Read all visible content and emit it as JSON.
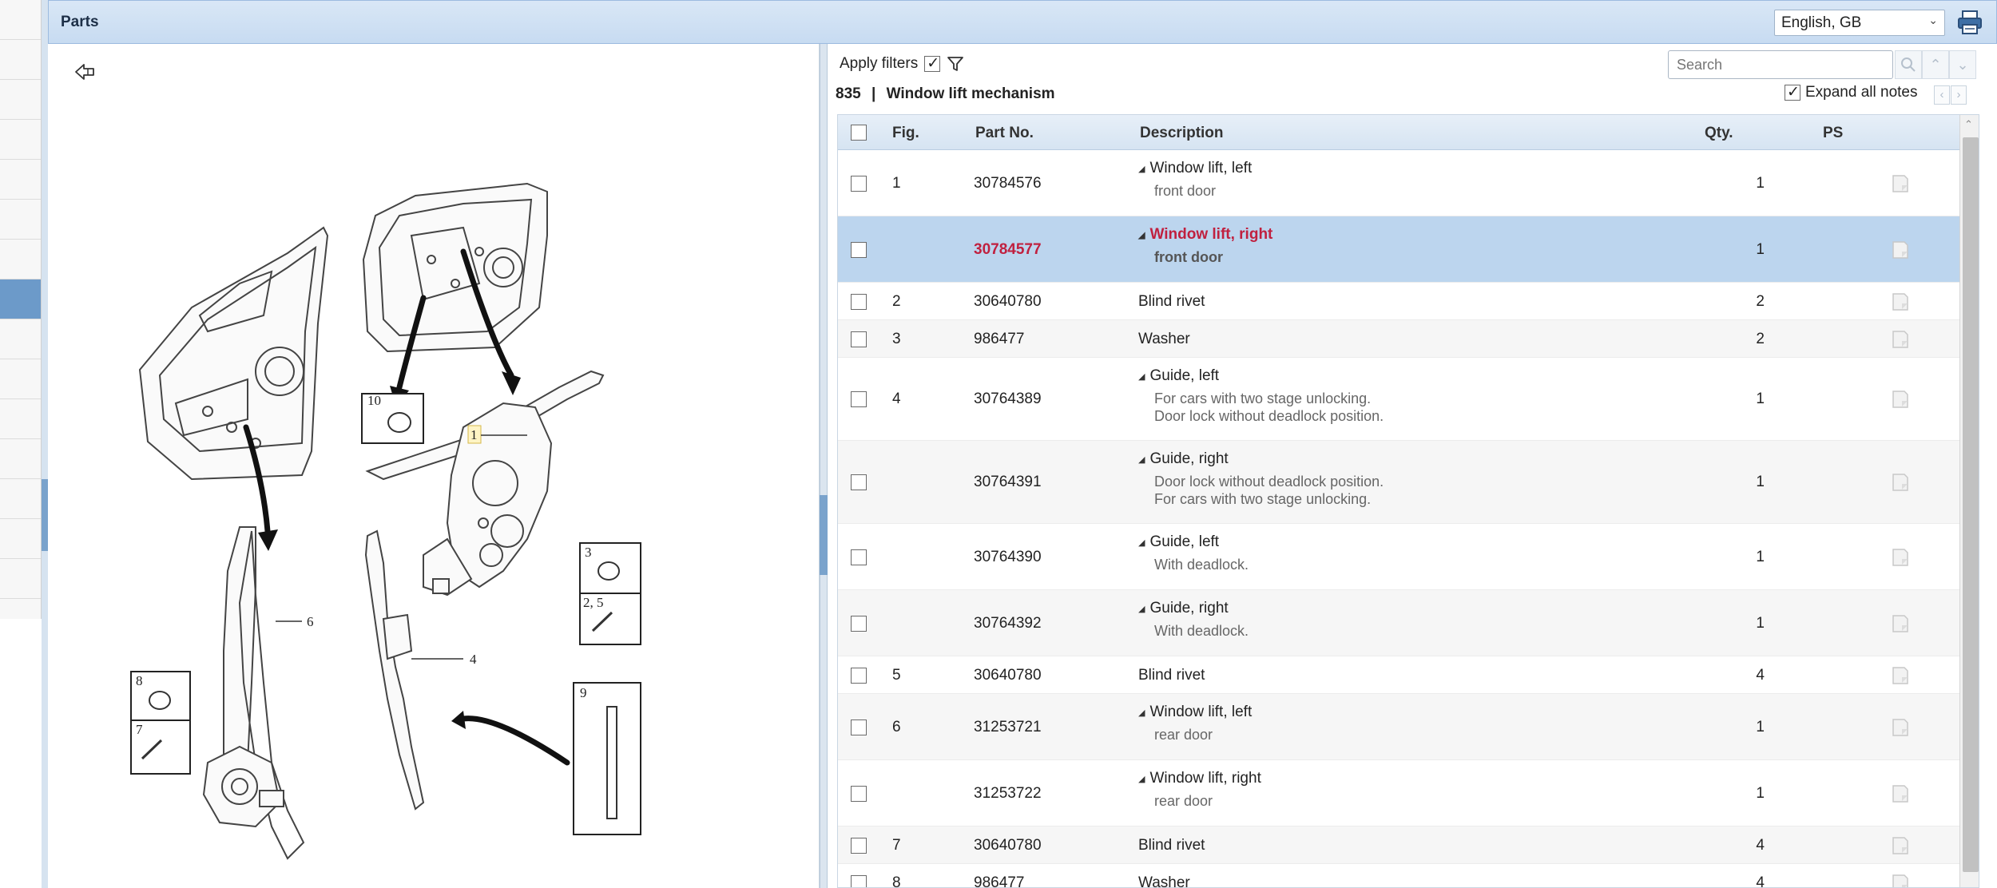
{
  "header": {
    "title": "Parts",
    "language": "English, GB"
  },
  "parts_panel": {
    "apply_filters_label": "Apply filters",
    "apply_filters_checked": true,
    "group_code": "835",
    "group_separator": "|",
    "group_name": "Window lift mechanism",
    "search_placeholder": "Search",
    "expand_all_notes_label": "Expand all notes",
    "expand_all_notes_checked": true
  },
  "table": {
    "columns": {
      "fig": "Fig.",
      "part_no": "Part No.",
      "description": "Description",
      "qty": "Qty.",
      "ps": "PS"
    },
    "rows": [
      {
        "fig": "1",
        "part_no": "30784576",
        "title": "Window lift, left",
        "notes": [
          "front door"
        ],
        "qty": "1",
        "expandable": true,
        "selected": false
      },
      {
        "fig": "",
        "part_no": "30784577",
        "title": "Window lift, right",
        "notes": [
          "front door"
        ],
        "qty": "1",
        "expandable": true,
        "selected": true
      },
      {
        "fig": "2",
        "part_no": "30640780",
        "title": "Blind rivet",
        "notes": [],
        "qty": "2",
        "expandable": false,
        "selected": false
      },
      {
        "fig": "3",
        "part_no": "986477",
        "title": "Washer",
        "notes": [],
        "qty": "2",
        "expandable": false,
        "selected": false
      },
      {
        "fig": "4",
        "part_no": "30764389",
        "title": "Guide, left",
        "notes": [
          "For cars with two stage unlocking.",
          "Door lock without deadlock position."
        ],
        "qty": "1",
        "expandable": true,
        "selected": false
      },
      {
        "fig": "",
        "part_no": "30764391",
        "title": "Guide, right",
        "notes": [
          "Door lock without deadlock position.",
          "For cars with two stage unlocking."
        ],
        "qty": "1",
        "expandable": true,
        "selected": false
      },
      {
        "fig": "",
        "part_no": "30764390",
        "title": "Guide, left",
        "notes": [
          "With deadlock."
        ],
        "qty": "1",
        "expandable": true,
        "selected": false
      },
      {
        "fig": "",
        "part_no": "30764392",
        "title": "Guide, right",
        "notes": [
          "With deadlock."
        ],
        "qty": "1",
        "expandable": true,
        "selected": false
      },
      {
        "fig": "5",
        "part_no": "30640780",
        "title": "Blind rivet",
        "notes": [],
        "qty": "4",
        "expandable": false,
        "selected": false
      },
      {
        "fig": "6",
        "part_no": "31253721",
        "title": "Window lift, left",
        "notes": [
          "rear door"
        ],
        "qty": "1",
        "expandable": true,
        "selected": false
      },
      {
        "fig": "",
        "part_no": "31253722",
        "title": "Window lift, right",
        "notes": [
          "rear door"
        ],
        "qty": "1",
        "expandable": true,
        "selected": false
      },
      {
        "fig": "7",
        "part_no": "30640780",
        "title": "Blind rivet",
        "notes": [],
        "qty": "4",
        "expandable": false,
        "selected": false
      },
      {
        "fig": "8",
        "part_no": "986477",
        "title": "Washer",
        "notes": [],
        "qty": "4",
        "expandable": false,
        "selected": false
      }
    ]
  },
  "diagram": {
    "callouts": {
      "c1": "1",
      "c3": "3",
      "c25": "2, 5",
      "c4": "4",
      "c6": "6",
      "c7": "7",
      "c8": "8",
      "c9": "9",
      "c10": "10"
    }
  },
  "colors": {
    "header_bg": "#c7dbf1",
    "selected_row": "#bcd5ee",
    "selected_text": "#c0203f",
    "accent": "#6c9ac9"
  },
  "icons": {
    "back": "back-arrow-icon",
    "print": "print-icon",
    "filter": "filter-icon",
    "search": "search-icon",
    "ps": "document-icon"
  }
}
